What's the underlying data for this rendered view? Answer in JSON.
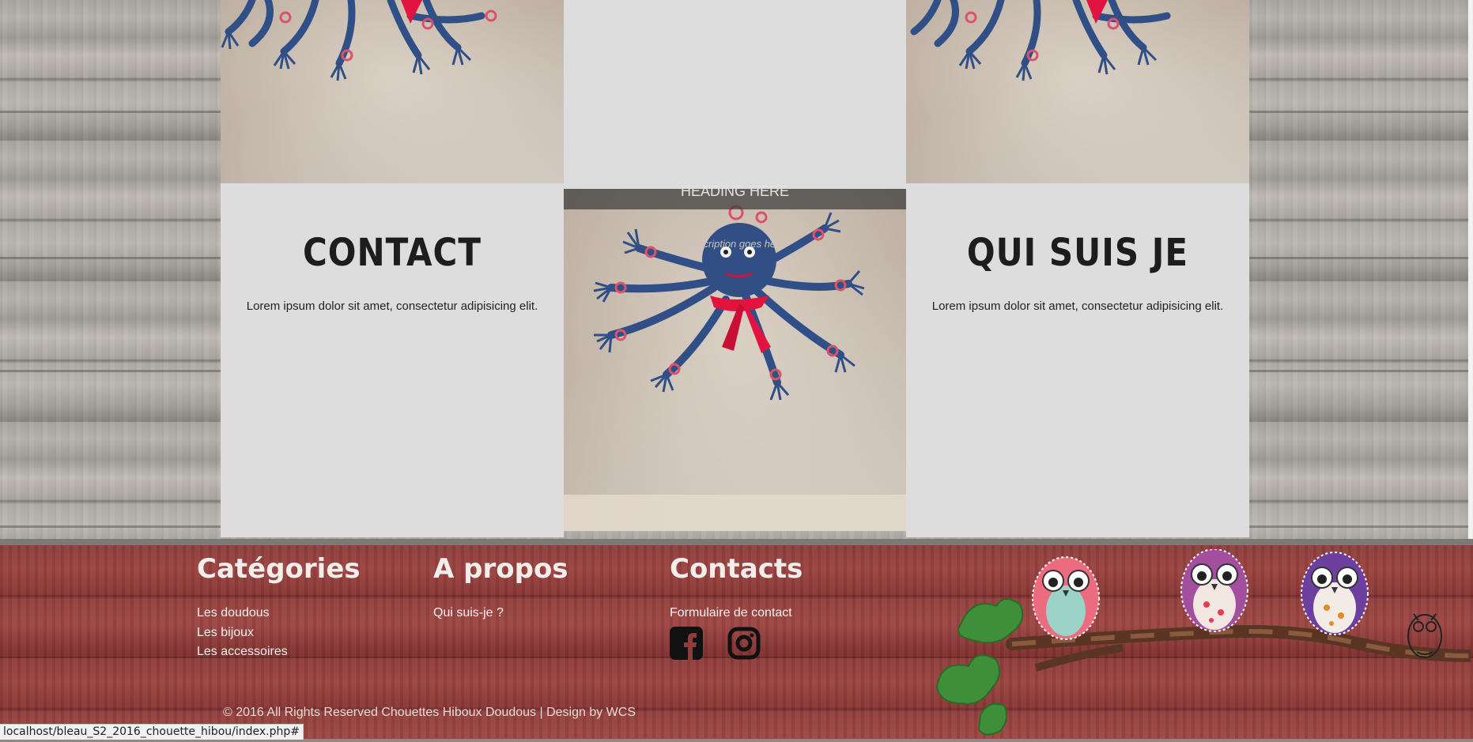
{
  "left_section": {
    "title": "CONTACT",
    "text": "Lorem ipsum dolor sit amet, consectetur adipisicing elit."
  },
  "right_section": {
    "title": "QUI SUIS JE",
    "text": "Lorem ipsum dolor sit amet, consectetur adipisicing elit."
  },
  "center_overlay": {
    "heading": "HEADING HERE",
    "description": "Description goes here"
  },
  "footer": {
    "categories": {
      "title": "Catégories",
      "links": [
        "Les doudous",
        "Les bijoux",
        "Les accessoires"
      ]
    },
    "apropos": {
      "title": "A propos",
      "links": [
        "Qui suis-je ?"
      ]
    },
    "contacts": {
      "title": "Contacts",
      "links": [
        "Formulaire de contact"
      ],
      "social": [
        "facebook-icon",
        "instagram-icon"
      ]
    },
    "copyright": "© 2016 All Rights Reserved Chouettes Hiboux Doudous | Design by WCS"
  },
  "status_bar": {
    "url": "localhost/bleau_S2_2016_chouette_hibou/index.php#"
  },
  "colors": {
    "panel": "#dddddd",
    "footer": "#8f3d3b",
    "yarn": "#2f4f86",
    "ribbon": "#e2143f"
  }
}
